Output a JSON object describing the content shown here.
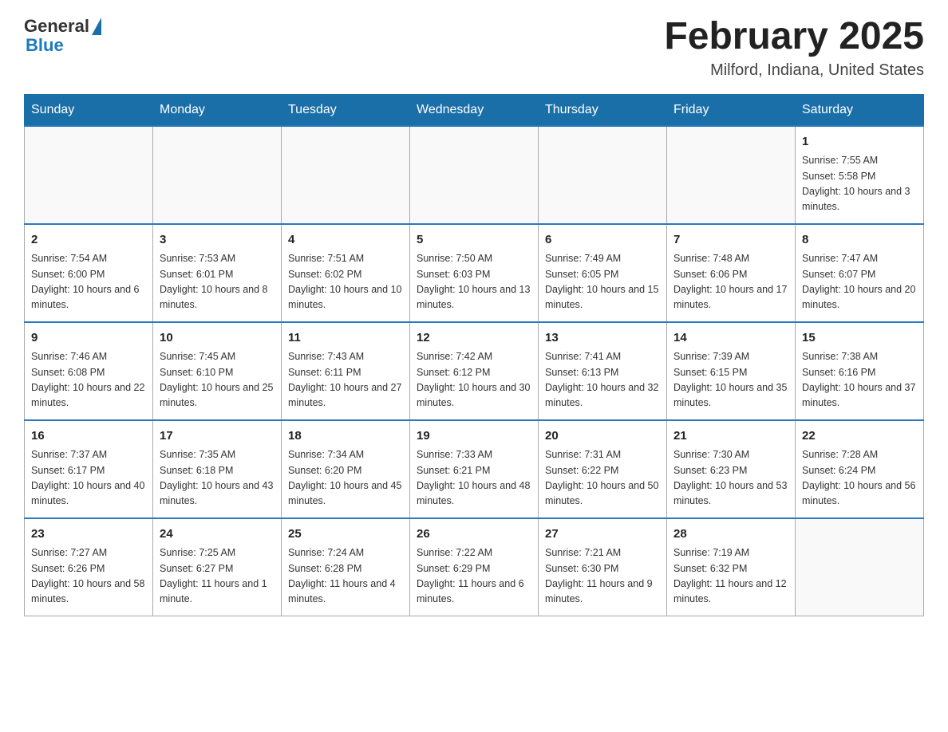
{
  "header": {
    "logo_general": "General",
    "logo_blue": "Blue",
    "month_title": "February 2025",
    "location": "Milford, Indiana, United States"
  },
  "weekdays": [
    "Sunday",
    "Monday",
    "Tuesday",
    "Wednesday",
    "Thursday",
    "Friday",
    "Saturday"
  ],
  "weeks": [
    [
      {
        "day": "",
        "info": ""
      },
      {
        "day": "",
        "info": ""
      },
      {
        "day": "",
        "info": ""
      },
      {
        "day": "",
        "info": ""
      },
      {
        "day": "",
        "info": ""
      },
      {
        "day": "",
        "info": ""
      },
      {
        "day": "1",
        "info": "Sunrise: 7:55 AM\nSunset: 5:58 PM\nDaylight: 10 hours and 3 minutes."
      }
    ],
    [
      {
        "day": "2",
        "info": "Sunrise: 7:54 AM\nSunset: 6:00 PM\nDaylight: 10 hours and 6 minutes."
      },
      {
        "day": "3",
        "info": "Sunrise: 7:53 AM\nSunset: 6:01 PM\nDaylight: 10 hours and 8 minutes."
      },
      {
        "day": "4",
        "info": "Sunrise: 7:51 AM\nSunset: 6:02 PM\nDaylight: 10 hours and 10 minutes."
      },
      {
        "day": "5",
        "info": "Sunrise: 7:50 AM\nSunset: 6:03 PM\nDaylight: 10 hours and 13 minutes."
      },
      {
        "day": "6",
        "info": "Sunrise: 7:49 AM\nSunset: 6:05 PM\nDaylight: 10 hours and 15 minutes."
      },
      {
        "day": "7",
        "info": "Sunrise: 7:48 AM\nSunset: 6:06 PM\nDaylight: 10 hours and 17 minutes."
      },
      {
        "day": "8",
        "info": "Sunrise: 7:47 AM\nSunset: 6:07 PM\nDaylight: 10 hours and 20 minutes."
      }
    ],
    [
      {
        "day": "9",
        "info": "Sunrise: 7:46 AM\nSunset: 6:08 PM\nDaylight: 10 hours and 22 minutes."
      },
      {
        "day": "10",
        "info": "Sunrise: 7:45 AM\nSunset: 6:10 PM\nDaylight: 10 hours and 25 minutes."
      },
      {
        "day": "11",
        "info": "Sunrise: 7:43 AM\nSunset: 6:11 PM\nDaylight: 10 hours and 27 minutes."
      },
      {
        "day": "12",
        "info": "Sunrise: 7:42 AM\nSunset: 6:12 PM\nDaylight: 10 hours and 30 minutes."
      },
      {
        "day": "13",
        "info": "Sunrise: 7:41 AM\nSunset: 6:13 PM\nDaylight: 10 hours and 32 minutes."
      },
      {
        "day": "14",
        "info": "Sunrise: 7:39 AM\nSunset: 6:15 PM\nDaylight: 10 hours and 35 minutes."
      },
      {
        "day": "15",
        "info": "Sunrise: 7:38 AM\nSunset: 6:16 PM\nDaylight: 10 hours and 37 minutes."
      }
    ],
    [
      {
        "day": "16",
        "info": "Sunrise: 7:37 AM\nSunset: 6:17 PM\nDaylight: 10 hours and 40 minutes."
      },
      {
        "day": "17",
        "info": "Sunrise: 7:35 AM\nSunset: 6:18 PM\nDaylight: 10 hours and 43 minutes."
      },
      {
        "day": "18",
        "info": "Sunrise: 7:34 AM\nSunset: 6:20 PM\nDaylight: 10 hours and 45 minutes."
      },
      {
        "day": "19",
        "info": "Sunrise: 7:33 AM\nSunset: 6:21 PM\nDaylight: 10 hours and 48 minutes."
      },
      {
        "day": "20",
        "info": "Sunrise: 7:31 AM\nSunset: 6:22 PM\nDaylight: 10 hours and 50 minutes."
      },
      {
        "day": "21",
        "info": "Sunrise: 7:30 AM\nSunset: 6:23 PM\nDaylight: 10 hours and 53 minutes."
      },
      {
        "day": "22",
        "info": "Sunrise: 7:28 AM\nSunset: 6:24 PM\nDaylight: 10 hours and 56 minutes."
      }
    ],
    [
      {
        "day": "23",
        "info": "Sunrise: 7:27 AM\nSunset: 6:26 PM\nDaylight: 10 hours and 58 minutes."
      },
      {
        "day": "24",
        "info": "Sunrise: 7:25 AM\nSunset: 6:27 PM\nDaylight: 11 hours and 1 minute."
      },
      {
        "day": "25",
        "info": "Sunrise: 7:24 AM\nSunset: 6:28 PM\nDaylight: 11 hours and 4 minutes."
      },
      {
        "day": "26",
        "info": "Sunrise: 7:22 AM\nSunset: 6:29 PM\nDaylight: 11 hours and 6 minutes."
      },
      {
        "day": "27",
        "info": "Sunrise: 7:21 AM\nSunset: 6:30 PM\nDaylight: 11 hours and 9 minutes."
      },
      {
        "day": "28",
        "info": "Sunrise: 7:19 AM\nSunset: 6:32 PM\nDaylight: 11 hours and 12 minutes."
      },
      {
        "day": "",
        "info": ""
      }
    ]
  ]
}
